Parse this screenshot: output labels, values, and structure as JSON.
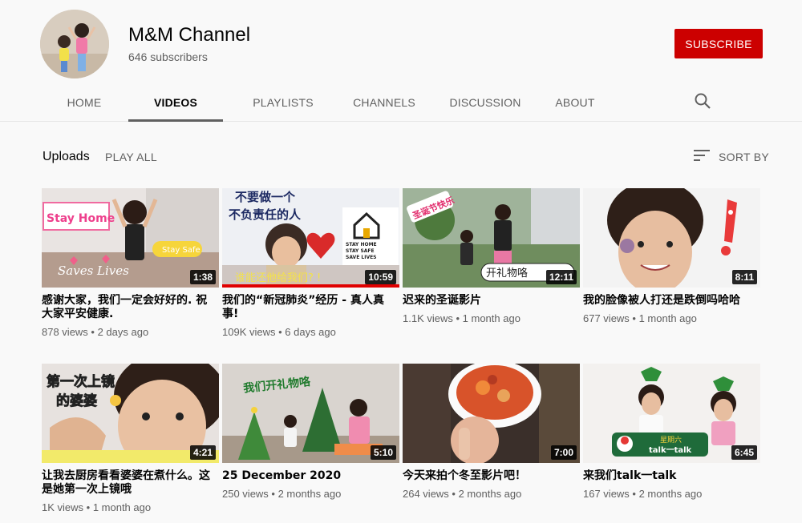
{
  "channel": {
    "name": "M&M Channel",
    "subscribers": "646 subscribers",
    "subscribe_label": "SUBSCRIBE"
  },
  "tabs": [
    {
      "label": "HOME",
      "active": false
    },
    {
      "label": "VIDEOS",
      "active": true
    },
    {
      "label": "PLAYLISTS",
      "active": false
    },
    {
      "label": "CHANNELS",
      "active": false
    },
    {
      "label": "DISCUSSION",
      "active": false
    },
    {
      "label": "ABOUT",
      "active": false
    }
  ],
  "icons": {
    "search": "search-icon",
    "sort": "sort-icon"
  },
  "uploads": {
    "title": "Uploads",
    "play_all": "PLAY ALL",
    "sort_by": "SORT BY"
  },
  "videos": [
    {
      "title": "感谢大家，我们一定会好好的. 祝大家平安健康.",
      "duration": "1:38",
      "views": "878 views",
      "age": "2 days ago",
      "overlay": [
        "Stay Home",
        "Stay Safe",
        "Saves Lives"
      ]
    },
    {
      "title": "我们的“新冠肺炎”经历 - 真人真事!",
      "duration": "10:59",
      "views": "109K views",
      "age": "6 days ago",
      "overlay": [
        "不要做一个",
        "不负责任的人",
        "谁能还他给我们? !",
        "STAY HOME",
        "STAY SAFE",
        "SAVE LIVES"
      ]
    },
    {
      "title": "迟来的圣诞影片",
      "duration": "12:11",
      "views": "1.1K views",
      "age": "1 month ago",
      "overlay": [
        "圣诞节快乐",
        "开礼物咯"
      ]
    },
    {
      "title": "我的脸像被人打还是跌倒吗哈哈",
      "duration": "8:11",
      "views": "677 views",
      "age": "1 month ago",
      "overlay": []
    },
    {
      "title": "让我去厨房看看婆婆在煮什么。这是她第一次上镜哦",
      "duration": "4:21",
      "views": "1K views",
      "age": "1 month ago",
      "overlay": [
        "第一次上镜",
        "的婆婆"
      ]
    },
    {
      "title": "25 December 2020",
      "duration": "5:10",
      "views": "250 views",
      "age": "2 months ago",
      "overlay": [
        "我们开礼物咯"
      ]
    },
    {
      "title": "今天来拍个冬至影片吧！",
      "duration": "7:00",
      "views": "264 views",
      "age": "2 months ago",
      "overlay": []
    },
    {
      "title": "来我们talk一talk",
      "duration": "6:45",
      "views": "167 views",
      "age": "2 months ago",
      "overlay": [
        "星期六",
        "talk一talk"
      ]
    }
  ],
  "colors": {
    "subscribe": "#cc0000",
    "text_secondary": "#606060",
    "text_primary": "#030303"
  }
}
